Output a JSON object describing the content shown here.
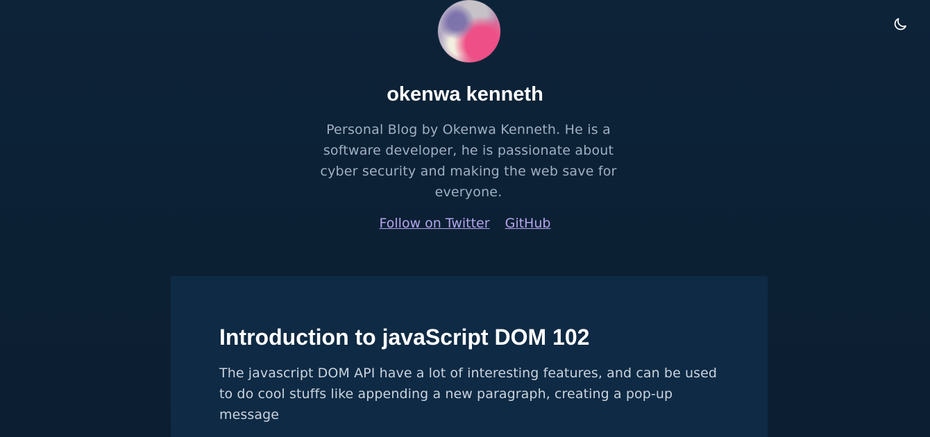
{
  "header": {
    "site_title": "okenwa kenneth",
    "bio": "Personal Blog by Okenwa Kenneth. He is a software developer, he is passionate about cyber security and making the web save for everyone.",
    "links": {
      "twitter": "Follow on Twitter",
      "github": "GitHub"
    },
    "theme_toggle_icon": "moon-icon"
  },
  "posts": [
    {
      "title": "Introduction to javaScript DOM 102",
      "excerpt": "The javascript DOM API have a lot of interesting features, and can be used to do cool stuffs like appending a new paragraph, creating a pop-up message"
    }
  ],
  "colors": {
    "background": "#0d2136",
    "card": "#0f2a44",
    "link": "#b4a6ec",
    "title": "#ffffff",
    "muted_text": "#9fb0c2"
  }
}
